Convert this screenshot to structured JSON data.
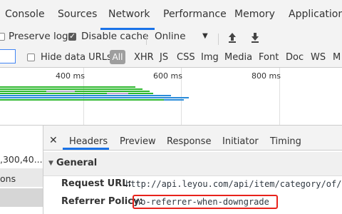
{
  "top_tabs": [
    "Console",
    "Sources",
    "Network",
    "Performance",
    "Memory",
    "Application"
  ],
  "active_tab": "Network",
  "toolbar": {
    "preserve_log": "Preserve log",
    "disable_cache": "Disable cache",
    "throttle_value": "Online",
    "preserve_checked": false,
    "disable_cache_checked": true
  },
  "filter": {
    "hide_data_urls": "Hide data URLs",
    "types": [
      "All",
      "XHR",
      "JS",
      "CSS",
      "Img",
      "Media",
      "Font",
      "Doc",
      "WS",
      "M"
    ]
  },
  "timeline": {
    "ticks": [
      "400 ms",
      "600 ms",
      "800 ms"
    ]
  },
  "request_list": {
    "row1": ",300,40...",
    "row2": "ons"
  },
  "detail_tabs": [
    "Headers",
    "Preview",
    "Response",
    "Initiator",
    "Timing"
  ],
  "active_detail_tab": "Headers",
  "general": {
    "title": "General",
    "request_url_key": "Request URL:",
    "request_url_val": "http://api.leyou.com/api/item/category/of/",
    "referrer_policy_key": "Referrer Policy:",
    "referrer_policy_val": "no-referrer-when-downgrade"
  },
  "colors": {
    "accent": "#1a73e8",
    "highlight_box": "#e8221b",
    "bar_green": "#2eb82e",
    "bar_blue": "#2b8cd9"
  }
}
